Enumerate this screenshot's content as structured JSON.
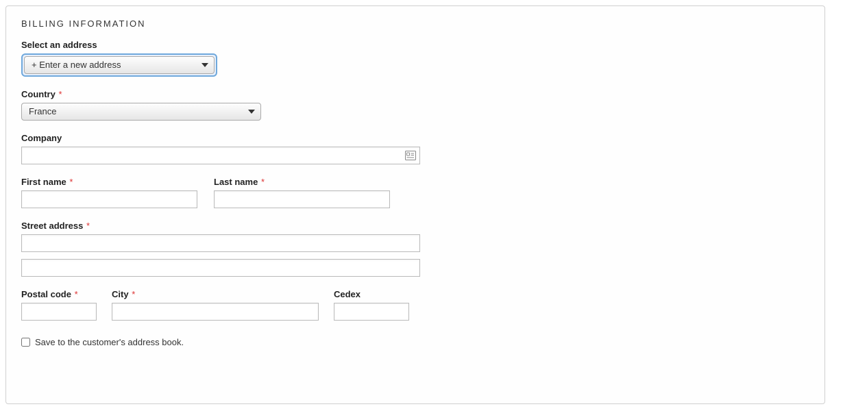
{
  "section_title": "BILLING INFORMATION",
  "address_selector": {
    "label": "Select an address",
    "value": "+ Enter a new address"
  },
  "country": {
    "label": "Country",
    "required": "*",
    "value": "France"
  },
  "company": {
    "label": "Company",
    "value": ""
  },
  "first_name": {
    "label": "First name",
    "required": "*",
    "value": ""
  },
  "last_name": {
    "label": "Last name",
    "required": "*",
    "value": ""
  },
  "street": {
    "label": "Street address",
    "required": "*",
    "line1": "",
    "line2": ""
  },
  "postal": {
    "label": "Postal code",
    "required": "*",
    "value": ""
  },
  "city": {
    "label": "City",
    "required": "*",
    "value": ""
  },
  "cedex": {
    "label": "Cedex",
    "value": ""
  },
  "save_checkbox": {
    "label": "Save to the customer's address book.",
    "checked": false
  }
}
